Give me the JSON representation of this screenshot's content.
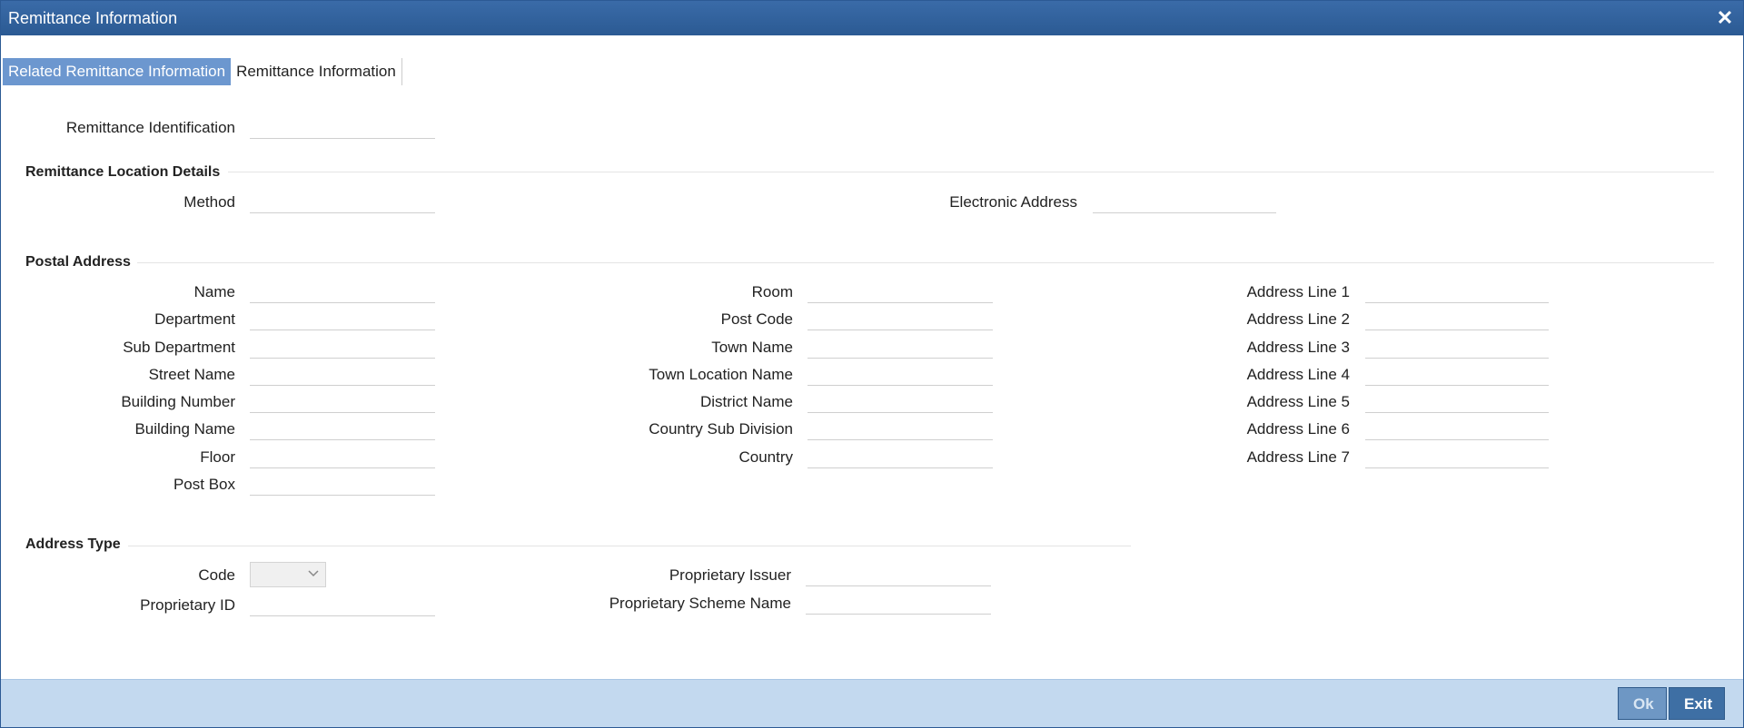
{
  "window": {
    "title": "Remittance Information"
  },
  "tabs": [
    {
      "label": "Related Remittance Information",
      "active": true
    },
    {
      "label": "Remittance Information",
      "active": false
    }
  ],
  "identification": {
    "label": "Remittance Identification",
    "value": ""
  },
  "location": {
    "title": "Remittance Location Details",
    "method_label": "Method",
    "method_value": "",
    "electronic_label": "Electronic Address",
    "electronic_value": ""
  },
  "postal": {
    "title": "Postal Address",
    "col1": [
      "Name",
      "Department",
      "Sub Department",
      "Street Name",
      "Building Number",
      "Building Name",
      "Floor",
      "Post Box"
    ],
    "col2": [
      "Room",
      "Post Code",
      "Town Name",
      "Town Location Name",
      "District Name",
      "Country Sub Division",
      "Country"
    ],
    "col3": [
      "Address Line 1",
      "Address Line 2",
      "Address Line 3",
      "Address Line 4",
      "Address Line 5",
      "Address Line 6",
      "Address Line 7"
    ]
  },
  "address_type": {
    "title": "Address Type",
    "code_label": "Code",
    "code_value": "",
    "proprietary_id_label": "Proprietary ID",
    "proprietary_issuer_label": "Proprietary Issuer",
    "proprietary_scheme_label": "Proprietary Scheme Name"
  },
  "footer": {
    "ok_label": "Ok",
    "exit_label": "Exit"
  },
  "colors": {
    "titlebar": "#2b5a93",
    "active_tab": "#6c97cf",
    "footer": "#c3d9ef"
  },
  "icons": {
    "close": "close-icon",
    "dropdown": "chevron-down-icon"
  }
}
